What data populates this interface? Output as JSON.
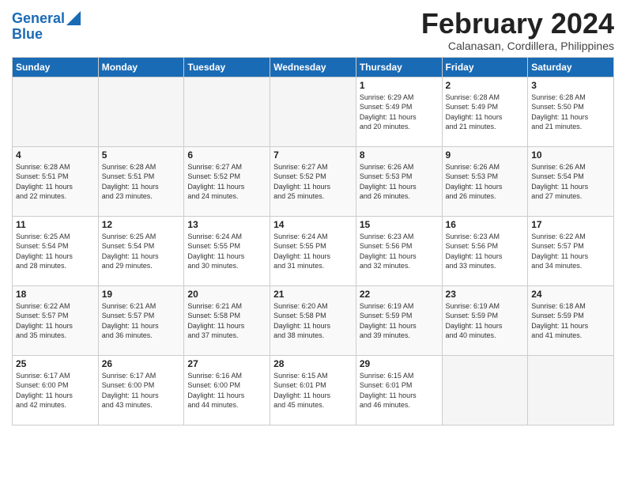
{
  "logo": {
    "line1": "General",
    "line2": "Blue"
  },
  "title": "February 2024",
  "subtitle": "Calanasan, Cordillera, Philippines",
  "headers": [
    "Sunday",
    "Monday",
    "Tuesday",
    "Wednesday",
    "Thursday",
    "Friday",
    "Saturday"
  ],
  "weeks": [
    [
      {
        "day": "",
        "info": ""
      },
      {
        "day": "",
        "info": ""
      },
      {
        "day": "",
        "info": ""
      },
      {
        "day": "",
        "info": ""
      },
      {
        "day": "1",
        "info": "Sunrise: 6:29 AM\nSunset: 5:49 PM\nDaylight: 11 hours\nand 20 minutes."
      },
      {
        "day": "2",
        "info": "Sunrise: 6:28 AM\nSunset: 5:49 PM\nDaylight: 11 hours\nand 21 minutes."
      },
      {
        "day": "3",
        "info": "Sunrise: 6:28 AM\nSunset: 5:50 PM\nDaylight: 11 hours\nand 21 minutes."
      }
    ],
    [
      {
        "day": "4",
        "info": "Sunrise: 6:28 AM\nSunset: 5:51 PM\nDaylight: 11 hours\nand 22 minutes."
      },
      {
        "day": "5",
        "info": "Sunrise: 6:28 AM\nSunset: 5:51 PM\nDaylight: 11 hours\nand 23 minutes."
      },
      {
        "day": "6",
        "info": "Sunrise: 6:27 AM\nSunset: 5:52 PM\nDaylight: 11 hours\nand 24 minutes."
      },
      {
        "day": "7",
        "info": "Sunrise: 6:27 AM\nSunset: 5:52 PM\nDaylight: 11 hours\nand 25 minutes."
      },
      {
        "day": "8",
        "info": "Sunrise: 6:26 AM\nSunset: 5:53 PM\nDaylight: 11 hours\nand 26 minutes."
      },
      {
        "day": "9",
        "info": "Sunrise: 6:26 AM\nSunset: 5:53 PM\nDaylight: 11 hours\nand 26 minutes."
      },
      {
        "day": "10",
        "info": "Sunrise: 6:26 AM\nSunset: 5:54 PM\nDaylight: 11 hours\nand 27 minutes."
      }
    ],
    [
      {
        "day": "11",
        "info": "Sunrise: 6:25 AM\nSunset: 5:54 PM\nDaylight: 11 hours\nand 28 minutes."
      },
      {
        "day": "12",
        "info": "Sunrise: 6:25 AM\nSunset: 5:54 PM\nDaylight: 11 hours\nand 29 minutes."
      },
      {
        "day": "13",
        "info": "Sunrise: 6:24 AM\nSunset: 5:55 PM\nDaylight: 11 hours\nand 30 minutes."
      },
      {
        "day": "14",
        "info": "Sunrise: 6:24 AM\nSunset: 5:55 PM\nDaylight: 11 hours\nand 31 minutes."
      },
      {
        "day": "15",
        "info": "Sunrise: 6:23 AM\nSunset: 5:56 PM\nDaylight: 11 hours\nand 32 minutes."
      },
      {
        "day": "16",
        "info": "Sunrise: 6:23 AM\nSunset: 5:56 PM\nDaylight: 11 hours\nand 33 minutes."
      },
      {
        "day": "17",
        "info": "Sunrise: 6:22 AM\nSunset: 5:57 PM\nDaylight: 11 hours\nand 34 minutes."
      }
    ],
    [
      {
        "day": "18",
        "info": "Sunrise: 6:22 AM\nSunset: 5:57 PM\nDaylight: 11 hours\nand 35 minutes."
      },
      {
        "day": "19",
        "info": "Sunrise: 6:21 AM\nSunset: 5:57 PM\nDaylight: 11 hours\nand 36 minutes."
      },
      {
        "day": "20",
        "info": "Sunrise: 6:21 AM\nSunset: 5:58 PM\nDaylight: 11 hours\nand 37 minutes."
      },
      {
        "day": "21",
        "info": "Sunrise: 6:20 AM\nSunset: 5:58 PM\nDaylight: 11 hours\nand 38 minutes."
      },
      {
        "day": "22",
        "info": "Sunrise: 6:19 AM\nSunset: 5:59 PM\nDaylight: 11 hours\nand 39 minutes."
      },
      {
        "day": "23",
        "info": "Sunrise: 6:19 AM\nSunset: 5:59 PM\nDaylight: 11 hours\nand 40 minutes."
      },
      {
        "day": "24",
        "info": "Sunrise: 6:18 AM\nSunset: 5:59 PM\nDaylight: 11 hours\nand 41 minutes."
      }
    ],
    [
      {
        "day": "25",
        "info": "Sunrise: 6:17 AM\nSunset: 6:00 PM\nDaylight: 11 hours\nand 42 minutes."
      },
      {
        "day": "26",
        "info": "Sunrise: 6:17 AM\nSunset: 6:00 PM\nDaylight: 11 hours\nand 43 minutes."
      },
      {
        "day": "27",
        "info": "Sunrise: 6:16 AM\nSunset: 6:00 PM\nDaylight: 11 hours\nand 44 minutes."
      },
      {
        "day": "28",
        "info": "Sunrise: 6:15 AM\nSunset: 6:01 PM\nDaylight: 11 hours\nand 45 minutes."
      },
      {
        "day": "29",
        "info": "Sunrise: 6:15 AM\nSunset: 6:01 PM\nDaylight: 11 hours\nand 46 minutes."
      },
      {
        "day": "",
        "info": ""
      },
      {
        "day": "",
        "info": ""
      }
    ]
  ]
}
